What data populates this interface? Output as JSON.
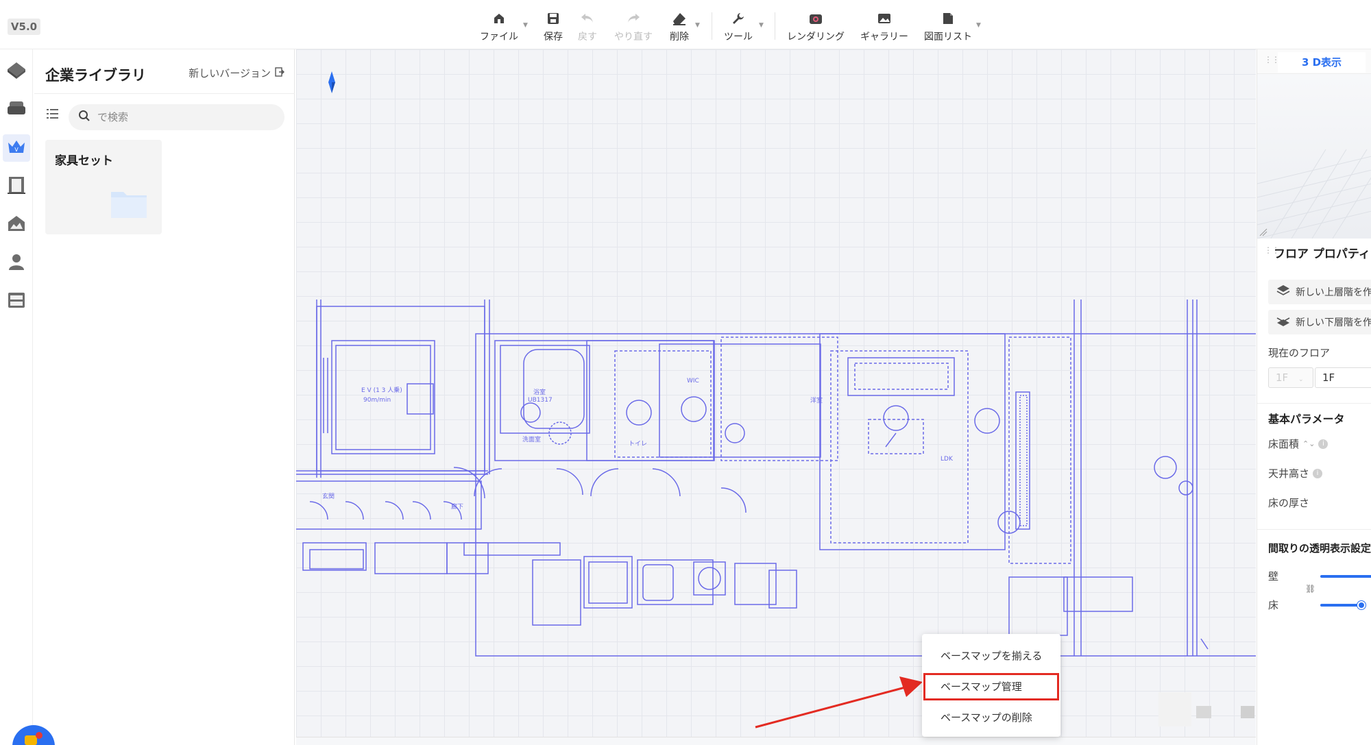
{
  "version": "V5.0",
  "toolbar": {
    "file": "ファイル",
    "save": "保存",
    "undo": "戻す",
    "redo": "やり直す",
    "delete": "削除",
    "tools": "ツール",
    "rendering": "レンダリング",
    "gallery": "ギャラリー",
    "drawing_list": "図面リスト"
  },
  "library": {
    "title": "企業ライブラリ",
    "new_version": "新しいバージョン",
    "search_placeholder": "で検索",
    "folder_name": "家具セット"
  },
  "plan_labels": {
    "ev": "E V (1 3 人乗)",
    "ev_speed": "90m/min",
    "bath": "浴室",
    "bath_model": "UB1317",
    "senmen": "洗面室",
    "toilet": "トイレ",
    "wic": "WIC",
    "yoshitsu": "洋室",
    "ldk": "LDK",
    "genkan": "玄関",
    "roka": "廊下"
  },
  "context_menu": {
    "align": "ベースマップを揃える",
    "manage": "ベースマップ管理",
    "delete": "ベースマップの削除"
  },
  "right_panel": {
    "tab_3d": "3 D表示",
    "floor_props_title": "フロア プロパティ",
    "new_upper": "新しい上層階を作",
    "new_lower": "新しい下層階を作",
    "current_floor": "現在のフロア",
    "floor_select_a": "1F",
    "floor_select_b": "1F",
    "basic_params": "基本パラメータ",
    "floor_area": "床面積",
    "ceiling_height": "天井高さ",
    "floor_thickness": "床の厚さ",
    "transparency_title": "間取りの透明表示設定",
    "wall": "壁",
    "floor": "床",
    "wall_opacity": 1.0,
    "floor_opacity": 0.4
  },
  "colors": {
    "accent": "#2a6ff0",
    "plan_line": "#6a6ae8",
    "highlight": "#e32b22"
  },
  "icons": {
    "rail": [
      "house-icon",
      "sofa-icon",
      "crown-icon",
      "door-icon",
      "landscape-icon",
      "user-icon",
      "cabinet-icon"
    ]
  }
}
